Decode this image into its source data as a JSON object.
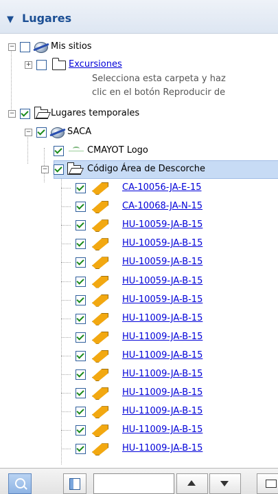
{
  "panel": {
    "title": "Lugares",
    "collapse_glyph": "▼"
  },
  "tree": {
    "mis_sitios": {
      "label": "Mis sitios"
    },
    "excursiones": {
      "label": "Excursiones",
      "description_line1": "Selecciona esta carpeta y haz",
      "description_line2": "clic en el botón Reproducir de"
    },
    "lugares_temporales": {
      "label": "Lugares temporales"
    },
    "saca": {
      "label": "SACA"
    },
    "cmayot": {
      "label": "CMAYOT Logo"
    },
    "codigo_area": {
      "label": "Código Área de Descorche"
    },
    "polygons": [
      "CA-10056-JA-E-15",
      "CA-10068-JA-N-15",
      "HU-10059-JA-B-15",
      "HU-10059-JA-B-15",
      "HU-10059-JA-B-15",
      "HU-10059-JA-B-15",
      "HU-10059-JA-B-15",
      "HU-11009-JA-B-15",
      "HU-11009-JA-B-15",
      "HU-11009-JA-B-15",
      "HU-11009-JA-B-15",
      "HU-11009-JA-B-15",
      "HU-11009-JA-B-15",
      "HU-11009-JA-B-15",
      "HU-11009-JA-B-15"
    ]
  },
  "toolbar": {
    "search_value": "",
    "icons": [
      "search-icon",
      "panel-toggle-icon",
      "arrow-up-icon",
      "arrow-down-icon",
      "folder-icon"
    ]
  },
  "colors": {
    "link": "#0000d8",
    "selection": "#c7dbf5",
    "header_text": "#1c4f94",
    "polygon_fill": "#f2a811"
  }
}
